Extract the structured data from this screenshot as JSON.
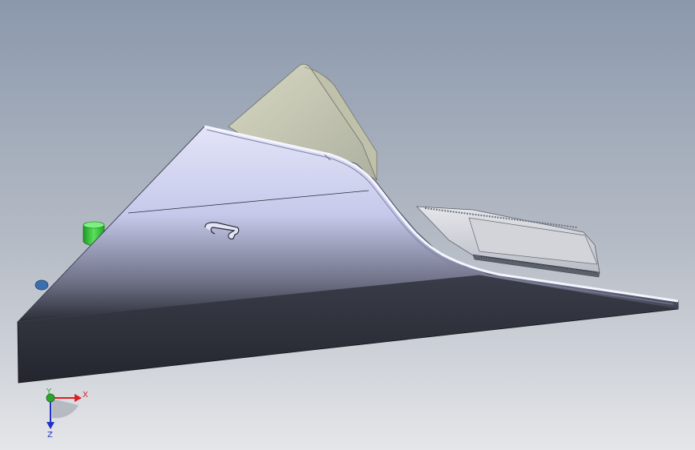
{
  "viewport": {
    "background_top": "#8b98ac",
    "background_bottom": "#dfe2e6"
  },
  "triad": {
    "x_label": "X",
    "y_label": "Y",
    "z_label": "Z",
    "x_color": "#e02020",
    "y_color": "#2aa62a",
    "z_color": "#2030c8"
  },
  "model": {
    "top_color": "#d3d6ee",
    "bottom_color": "#2c2f38",
    "back_panel_color": "#c9c9ad",
    "tray_color": "#d9dbdf",
    "green_part_color": "#36c63a",
    "blue_part_color": "#3a6fae"
  }
}
